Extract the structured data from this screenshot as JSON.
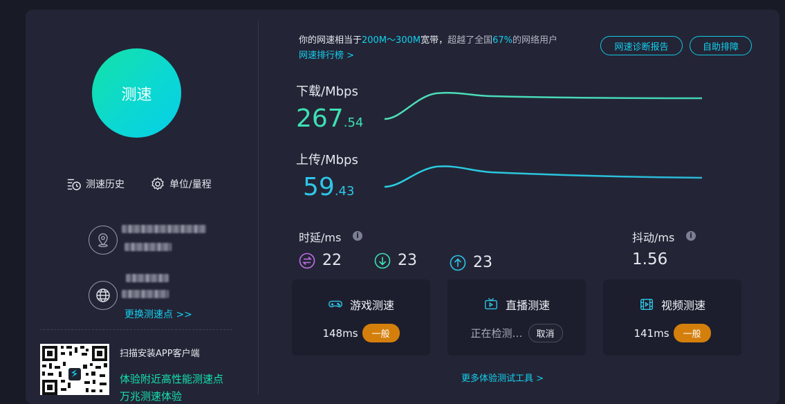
{
  "colors": {
    "accent": "#14d0ee",
    "download": "#3ee1b4",
    "upload": "#2ec6e8",
    "badge": "#d47f0c"
  },
  "left": {
    "speed_button": "测速",
    "history": "测速历史",
    "units": "单位/量程",
    "change_node": "更换测速点 >>",
    "scan_title": "扫描安装APP客户端",
    "scan_line1": "体验附近高性能测速点",
    "scan_line2": "万兆测速体验"
  },
  "summary": {
    "prefix": "你的网速相当于",
    "range": "200M～300M",
    "mid": "宽带，",
    "beat": "超越了全国",
    "percent": "67%",
    "tail": "的网络用户",
    "rank_link": "网速排行榜 >"
  },
  "buttons": {
    "report": "网速诊断报告",
    "troubleshoot": "自助排障"
  },
  "download": {
    "label": "下载/Mbps",
    "int": "267",
    "dec": ".54"
  },
  "upload": {
    "label": "上传/Mbps",
    "int": "59",
    "dec": ".43"
  },
  "latency": {
    "label": "时延/ms",
    "idle": "22",
    "down": "23",
    "up": "23"
  },
  "jitter": {
    "label": "抖动/ms",
    "value": "1.56"
  },
  "info_glyph": "i",
  "cards": {
    "game": {
      "title": "游戏测速",
      "value": "148ms",
      "badge": "一般"
    },
    "live": {
      "title": "直播测速",
      "status": "正在检测…",
      "cancel": "取消"
    },
    "video": {
      "title": "视频测速",
      "value": "141ms",
      "badge": "一般"
    }
  },
  "more_tools": "更多体验测试工具 >"
}
